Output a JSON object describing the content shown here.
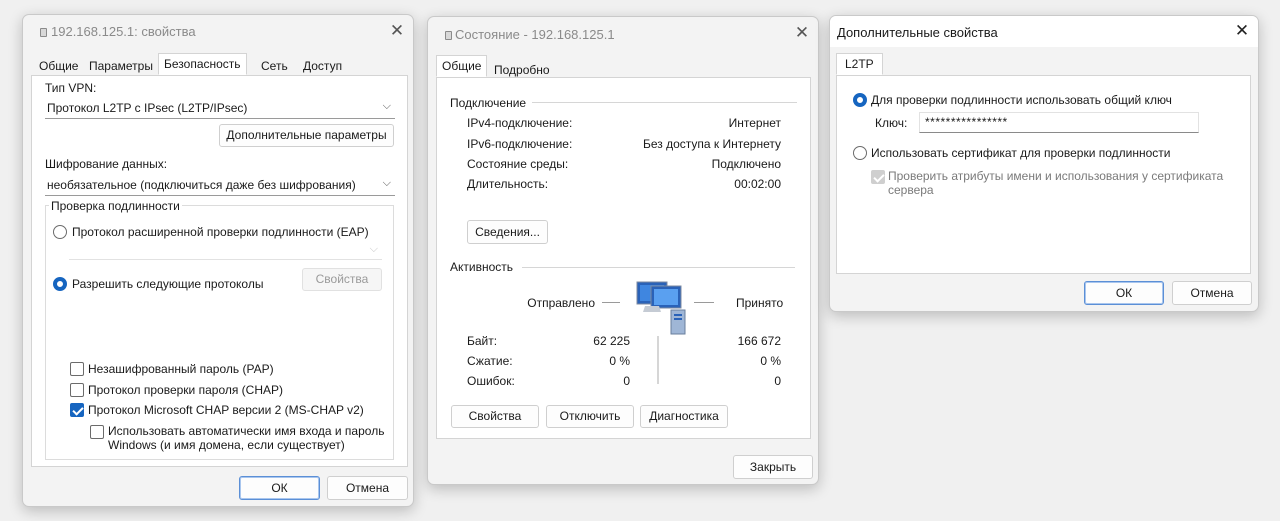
{
  "vpn_props": {
    "title": "192.168.125.1: свойства",
    "tabs": [
      "Общие",
      "Параметры",
      "Безопасность",
      "Сеть",
      "Доступ"
    ],
    "vpn_type_label": "Тип VPN:",
    "vpn_type_value": "Протокол L2TP с IPsec (L2TP/IPsec)",
    "advanced_button": "Дополнительные параметры",
    "encryption_label": "Шифрование данных:",
    "encryption_value": "необязательное (подключиться даже без шифрования)",
    "auth_group": "Проверка подлинности",
    "eap_radio": "Протокол расширенной проверки подлинности (EAP)",
    "allow_radio": "Разрешить следующие протоколы",
    "properties_button": "Свойства",
    "pap": "Незашифрованный пароль (PAP)",
    "chap": "Протокол проверки пароля (CHAP)",
    "mschap": "Протокол Microsoft CHAP версии 2 (MS-CHAP v2)",
    "auto_login_line1": "Использовать автоматически имя входа и пароль",
    "auto_login_line2": "Windows (и имя домена, если существует)",
    "ok": "ОК",
    "cancel": "Отмена"
  },
  "status": {
    "title": "Состояние - 192.168.125.1",
    "tabs": [
      "Общие",
      "Подробно"
    ],
    "connection_header": "Подключение",
    "rows": [
      {
        "label": "IPv4-подключение:",
        "value": "Интернет"
      },
      {
        "label": "IPv6-подключение:",
        "value": "Без доступа к Интернету"
      },
      {
        "label": "Состояние среды:",
        "value": "Подключено"
      },
      {
        "label": "Длительность:",
        "value": "00:02:00"
      }
    ],
    "details_button": "Сведения...",
    "activity_header": "Активность",
    "sent_label": "Отправлено",
    "received_label": "Принято",
    "stats": [
      {
        "label": "Байт:",
        "sent": "62 225",
        "received": "166 672"
      },
      {
        "label": "Сжатие:",
        "sent": "0 %",
        "received": "0 %"
      },
      {
        "label": "Ошибок:",
        "sent": "0",
        "received": "0"
      }
    ],
    "properties_button": "Свойства",
    "disconnect_button": "Отключить",
    "diagnostics_button": "Диагностика",
    "close_button": "Закрыть"
  },
  "advanced": {
    "title": "Дополнительные свойства",
    "tab": "L2TP",
    "psk_radio": "Для проверки подлинности использовать общий ключ",
    "key_label": "Ключ:",
    "key_value": "****************",
    "cert_radio": "Использовать сертификат для проверки подлинности",
    "verify_line1": "Проверить атрибуты имени и использования у сертификата",
    "verify_line2": "сервера",
    "ok": "ОК",
    "cancel": "Отмена"
  },
  "icons": {
    "network_icon": "network-computers-icon",
    "close": "close-icon",
    "chevron": "chevron-down-icon"
  }
}
